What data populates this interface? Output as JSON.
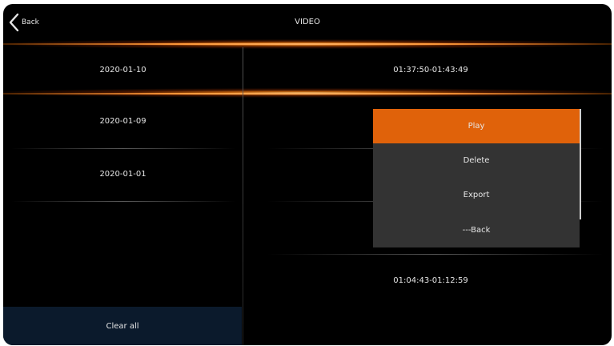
{
  "header": {
    "back_label": "Back",
    "title": "VIDEO",
    "back_icon": "chevron-left-icon"
  },
  "dates": [
    {
      "label": "2020-01-10",
      "selected": true
    },
    {
      "label": "2020-01-09",
      "selected": false
    },
    {
      "label": "2020-01-01",
      "selected": false
    }
  ],
  "clips": [
    {
      "label": "01:37:50-01:43:49",
      "selected": true
    },
    {
      "label": "01:04:43-01:12:59",
      "selected": false
    }
  ],
  "clear_all_label": "Clear  all",
  "menu": {
    "items": [
      {
        "label": "Play",
        "active": true
      },
      {
        "label": "Delete",
        "active": false
      },
      {
        "label": "Export",
        "active": false
      },
      {
        "label": "---Back",
        "active": false
      }
    ]
  },
  "colors": {
    "background": "#000000",
    "accent_orange": "#e0620a",
    "menu_background": "#333333",
    "clear_all_background": "#0b1a2c",
    "text": "#e6e6e6"
  }
}
